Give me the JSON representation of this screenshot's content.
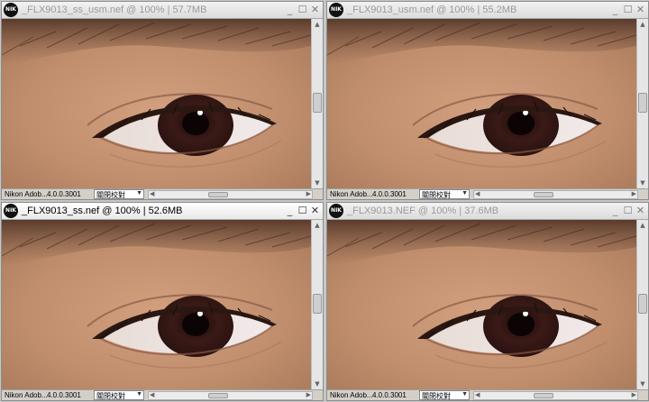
{
  "windows": [
    {
      "id": "w1",
      "title": "_FLX9013_ss_usm.nef @ 100% | 57.7MB",
      "active": false,
      "status": {
        "app": "Nikon Adob...",
        "version": "4.0.0.3001",
        "dropdown": "關閉校對"
      }
    },
    {
      "id": "w2",
      "title": "_FLX9013_usm.nef @ 100% | 55.2MB",
      "active": false,
      "status": {
        "app": "Nikon Adob...",
        "version": "4.0.0.3001",
        "dropdown": "關閉校對"
      }
    },
    {
      "id": "w3",
      "title": "_FLX9013_ss.nef @ 100% | 52.6MB",
      "active": true,
      "status": {
        "app": "Nikon Adob...",
        "version": "4.0.0.3001",
        "dropdown": "關閉校對"
      }
    },
    {
      "id": "w4",
      "title": "_FLX9013.NEF @ 100% | 37.6MB",
      "active": false,
      "status": {
        "app": "Nikon Adob...",
        "version": "4.0.0.3001",
        "dropdown": "關閉校對"
      }
    }
  ],
  "logo_text": "NIK",
  "controls": {
    "minimize": "_",
    "maximize": "☐",
    "close": "✕"
  },
  "icons": {
    "logo": "nikon-logo-icon",
    "minimize": "minimize-icon",
    "maximize": "maximize-icon",
    "close": "close-icon"
  },
  "colors": {
    "skin": "#c0906e",
    "iris": "#2a1210",
    "titlebar_active": "#ffffff",
    "titlebar_inactive": "#dcdcdc"
  }
}
